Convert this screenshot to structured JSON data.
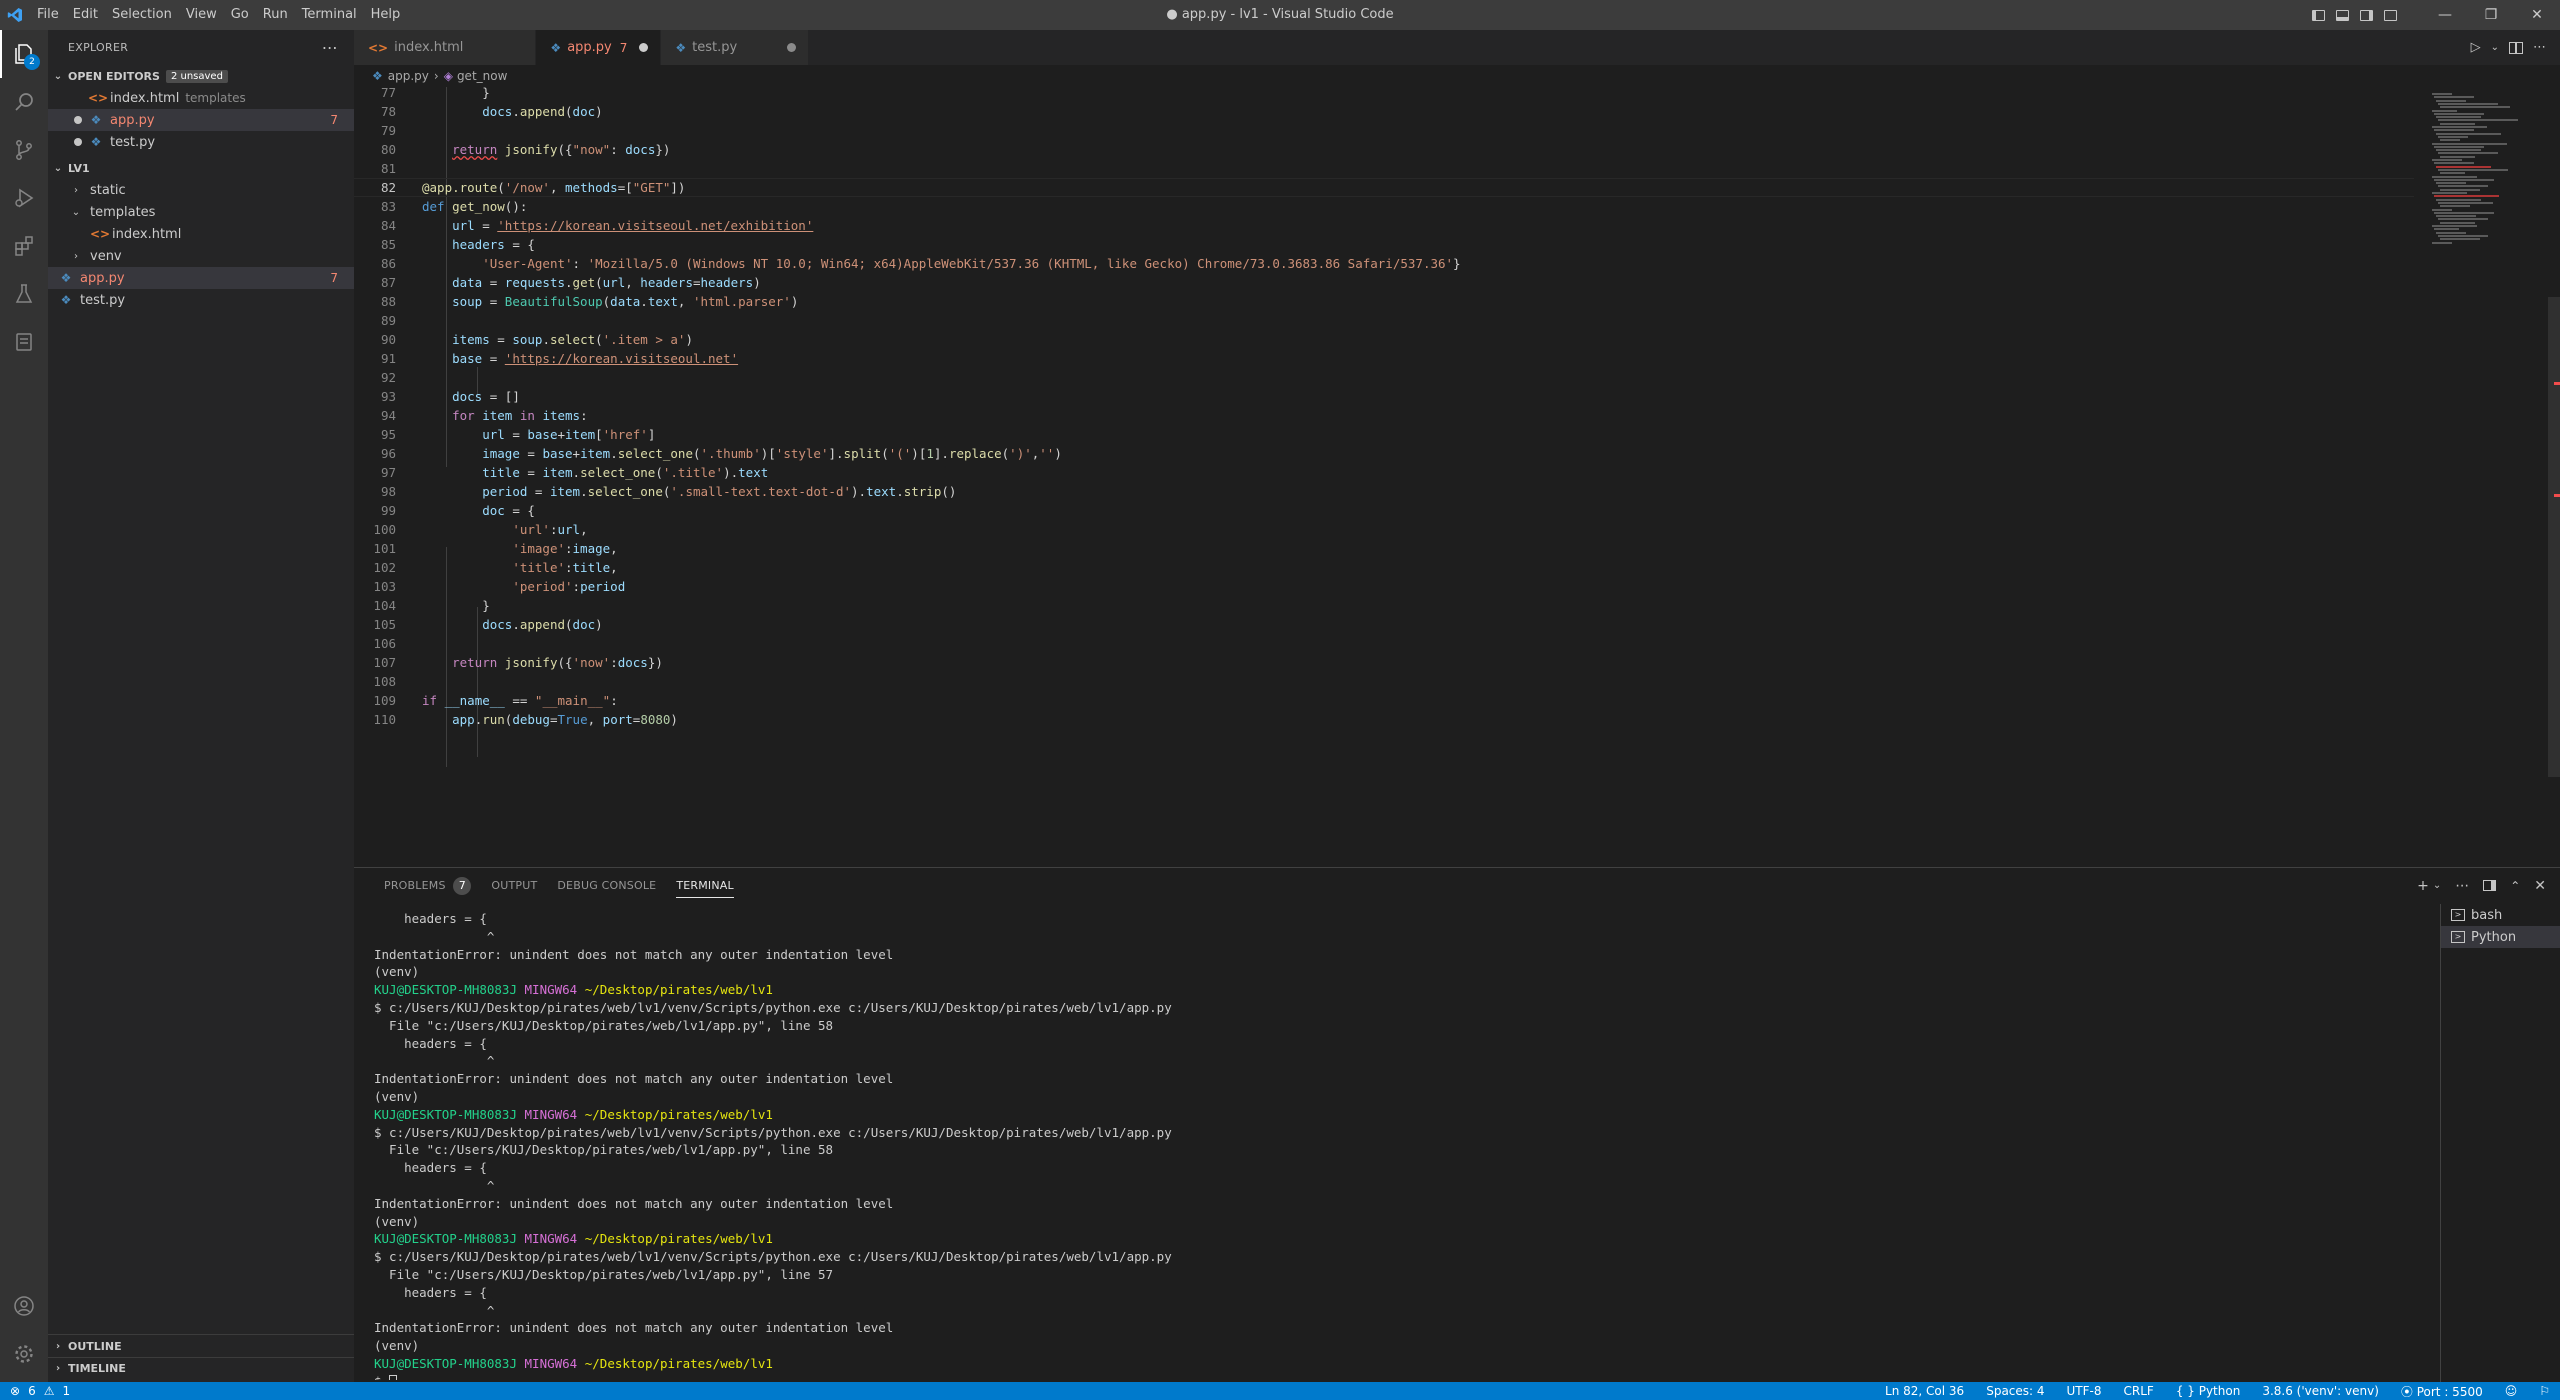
{
  "window": {
    "title": "● app.py - lv1 - Visual Studio Code",
    "menu": [
      "File",
      "Edit",
      "Selection",
      "View",
      "Go",
      "Run",
      "Terminal",
      "Help"
    ]
  },
  "activity": {
    "explorer_badge": "2"
  },
  "sidebar": {
    "header": "EXPLORER",
    "open_editors_label": "OPEN EDITORS",
    "unsaved_badge": "2 unsaved",
    "open_editors": [
      {
        "name": "index.html",
        "desc": "templates",
        "icon": "html-file-icon"
      },
      {
        "name": "app.py",
        "desc": "",
        "count": "7",
        "icon": "python-file-icon",
        "modified": true
      },
      {
        "name": "test.py",
        "desc": "",
        "icon": "python-file-icon"
      }
    ],
    "project_label": "LV1",
    "tree": [
      {
        "name": "static",
        "kind": "folder"
      },
      {
        "name": "templates",
        "kind": "folder-open"
      },
      {
        "name": "index.html",
        "kind": "file"
      },
      {
        "name": "venv",
        "kind": "folder"
      },
      {
        "name": "app.py",
        "kind": "file",
        "count": "7"
      },
      {
        "name": "test.py",
        "kind": "file"
      }
    ],
    "outline_label": "OUTLINE",
    "timeline_label": "TIMELINE"
  },
  "tabs": [
    {
      "name": "index.html",
      "icon": "html-file-icon"
    },
    {
      "name": "app.py",
      "errors": "7",
      "active": true
    },
    {
      "name": "test.py"
    }
  ],
  "breadcrumb": {
    "file": "app.py",
    "symbol": "get_now"
  },
  "editor": {
    "current_line": 82,
    "lines": [
      {
        "n": "77",
        "text": "        }"
      },
      {
        "n": "78",
        "text": "        docs.append(doc)"
      },
      {
        "n": "79",
        "text": ""
      },
      {
        "n": "80",
        "text": "    return jsonify({\"now\": docs})"
      },
      {
        "n": "81",
        "text": ""
      },
      {
        "n": "82",
        "text": "@app.route('/now', methods=[\"GET\"])"
      },
      {
        "n": "83",
        "text": "def get_now():"
      },
      {
        "n": "84",
        "text": "    url = 'https://korean.visitseoul.net/exhibition'"
      },
      {
        "n": "85",
        "text": "    headers = {"
      },
      {
        "n": "86",
        "text": "        'User-Agent': 'Mozilla/5.0 (Windows NT 10.0; Win64; x64)AppleWebKit/537.36 (KHTML, like Gecko) Chrome/73.0.3683.86 Safari/537.36'}"
      },
      {
        "n": "87",
        "text": "    data = requests.get(url, headers=headers)"
      },
      {
        "n": "88",
        "text": "    soup = BeautifulSoup(data.text, 'html.parser')"
      },
      {
        "n": "89",
        "text": ""
      },
      {
        "n": "90",
        "text": "    items = soup.select('.item > a')"
      },
      {
        "n": "91",
        "text": "    base = 'https://korean.visitseoul.net'"
      },
      {
        "n": "92",
        "text": ""
      },
      {
        "n": "93",
        "text": "    docs = []"
      },
      {
        "n": "94",
        "text": "    for item in items:"
      },
      {
        "n": "95",
        "text": "        url = base+item['href']"
      },
      {
        "n": "96",
        "text": "        image = base+item.select_one('.thumb')['style'].split('(')[1].replace(')','')"
      },
      {
        "n": "97",
        "text": "        title = item.select_one('.title').text"
      },
      {
        "n": "98",
        "text": "        period = item.select_one('.small-text.text-dot-d').text.strip()"
      },
      {
        "n": "99",
        "text": "        doc = {"
      },
      {
        "n": "100",
        "text": "            'url':url,"
      },
      {
        "n": "101",
        "text": "            'image':image,"
      },
      {
        "n": "102",
        "text": "            'title':title,"
      },
      {
        "n": "103",
        "text": "            'period':period"
      },
      {
        "n": "104",
        "text": "        }"
      },
      {
        "n": "105",
        "text": "        docs.append(doc)"
      },
      {
        "n": "106",
        "text": ""
      },
      {
        "n": "107",
        "text": "    return jsonify({'now':docs})"
      },
      {
        "n": "108",
        "text": ""
      },
      {
        "n": "109",
        "text": "if __name__ == \"__main__\":"
      },
      {
        "n": "110",
        "text": "    app.run(debug=True, port=8080)"
      }
    ]
  },
  "panel": {
    "tabs": [
      {
        "label": "PROBLEMS",
        "count": "7"
      },
      {
        "label": "OUTPUT"
      },
      {
        "label": "DEBUG CONSOLE"
      },
      {
        "label": "TERMINAL",
        "active": true
      }
    ],
    "terminal_lines": [
      "    headers = {",
      "               ^",
      "IndentationError: unindent does not match any outer indentation level",
      "(venv)",
      "KUJ@DESKTOP-MH8083J MINGW64 ~/Desktop/pirates/web/lv1",
      "$ c:/Users/KUJ/Desktop/pirates/web/lv1/venv/Scripts/python.exe c:/Users/KUJ/Desktop/pirates/web/lv1/app.py",
      "  File \"c:/Users/KUJ/Desktop/pirates/web/lv1/app.py\", line 58",
      "    headers = {",
      "               ^",
      "IndentationError: unindent does not match any outer indentation level",
      "(venv)",
      "KUJ@DESKTOP-MH8083J MINGW64 ~/Desktop/pirates/web/lv1",
      "$ c:/Users/KUJ/Desktop/pirates/web/lv1/venv/Scripts/python.exe c:/Users/KUJ/Desktop/pirates/web/lv1/app.py",
      "  File \"c:/Users/KUJ/Desktop/pirates/web/lv1/app.py\", line 58",
      "    headers = {",
      "               ^",
      "IndentationError: unindent does not match any outer indentation level",
      "(venv)",
      "KUJ@DESKTOP-MH8083J MINGW64 ~/Desktop/pirates/web/lv1",
      "$ c:/Users/KUJ/Desktop/pirates/web/lv1/venv/Scripts/python.exe c:/Users/KUJ/Desktop/pirates/web/lv1/app.py",
      "  File \"c:/Users/KUJ/Desktop/pirates/web/lv1/app.py\", line 57",
      "    headers = {",
      "               ^",
      "IndentationError: unindent does not match any outer indentation level",
      "(venv)",
      "KUJ@DESKTOP-MH8083J MINGW64 ~/Desktop/pirates/web/lv1",
      "$ "
    ],
    "terminals": [
      {
        "name": "bash"
      },
      {
        "name": "Python",
        "selected": true
      }
    ]
  },
  "statusbar": {
    "errors": "6",
    "warnings": "1",
    "position": "Ln 82, Col 36",
    "spaces": "Spaces: 4",
    "encoding": "UTF-8",
    "eol": "CRLF",
    "language": "Python",
    "interpreter": "3.8.6 ('venv': venv)",
    "port": "Port : 5500"
  },
  "colors": {
    "accent": "#007acc",
    "error": "#f48771",
    "background": "#1e1e1e"
  }
}
